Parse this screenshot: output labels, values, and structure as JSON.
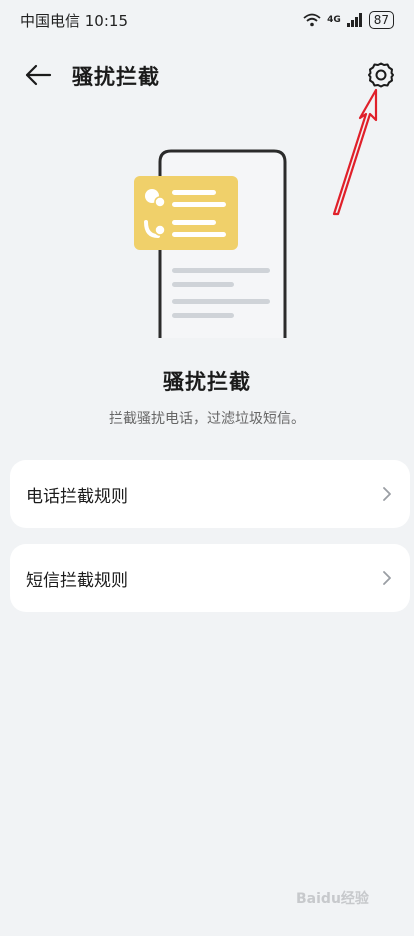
{
  "status_bar": {
    "carrier_time": "中国电信 10:15",
    "network": "4G",
    "battery": "87",
    "wifi_icon": "wifi-icon",
    "signal_icon": "signal-icon"
  },
  "app_bar": {
    "title": "骚扰拦截",
    "back_icon": "back-arrow-icon",
    "settings_icon": "gear-icon"
  },
  "hero": {
    "title": "骚扰拦截",
    "description": "拦截骚扰电话，过滤垃圾短信。"
  },
  "menu": {
    "items": [
      {
        "label": "电话拦截规则",
        "icon": "chevron-right-icon"
      },
      {
        "label": "短信拦截规则",
        "icon": "chevron-right-icon"
      }
    ]
  },
  "watermark": {
    "text": "Baidu经验"
  },
  "colors": {
    "background": "#f1f3f5",
    "card": "#ffffff",
    "illustration_card": "#f0d06a",
    "annotation_arrow": "#e0202a"
  }
}
